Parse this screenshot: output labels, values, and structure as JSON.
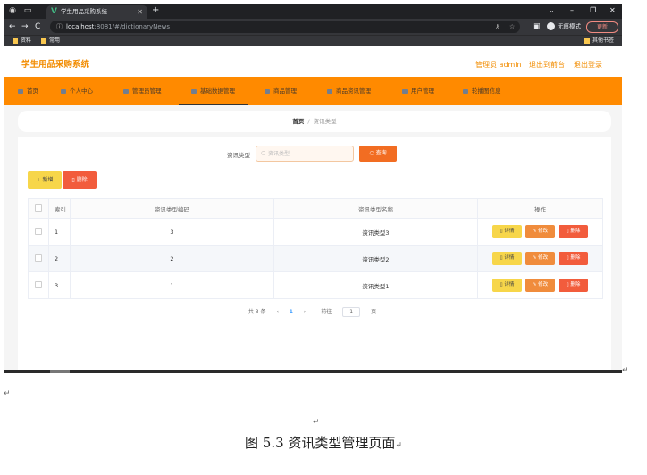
{
  "browser": {
    "tab_title": "学生用品采购系统",
    "url_host": "localhost",
    "url_rest": ":8081/#/dictionaryNews",
    "incognito_label": "无痕模式",
    "update_label": "更新",
    "bookmarks": [
      "资料",
      "常用"
    ],
    "other_bookmarks": "其他书签"
  },
  "header": {
    "brand": "学生用品采购系统",
    "admin_label": "管理员 admin",
    "back_label": "退出到前台",
    "logout_label": "退出登录"
  },
  "menu": {
    "items": [
      {
        "label": "首页",
        "icon": "home-icon"
      },
      {
        "label": "个人中心",
        "icon": "user-icon"
      },
      {
        "label": "管理员管理",
        "icon": "admin-icon"
      },
      {
        "label": "基础数据管理",
        "icon": "data-icon",
        "active": true
      },
      {
        "label": "商品管理",
        "icon": "goods-icon"
      },
      {
        "label": "商品资讯管理",
        "icon": "news-icon"
      },
      {
        "label": "用户管理",
        "icon": "users-icon"
      },
      {
        "label": "轮播图信息",
        "icon": "carousel-icon"
      }
    ]
  },
  "breadcrumb": {
    "home": "首页",
    "separator": "/",
    "current": "资讯类型"
  },
  "search": {
    "label": "资讯类型",
    "placeholder": "资讯类型",
    "button_label": "查询"
  },
  "toolbar": {
    "add_label": "+ 新增",
    "delete_label": "删除"
  },
  "table": {
    "headers": [
      "索引",
      "资讯类型编码",
      "资讯类型名称",
      "操作"
    ],
    "rows": [
      {
        "index": "1",
        "code": "3",
        "name": "资讯类型3"
      },
      {
        "index": "2",
        "code": "2",
        "name": "资讯类型2"
      },
      {
        "index": "3",
        "code": "1",
        "name": "资讯类型1"
      }
    ],
    "actions": {
      "view": "详情",
      "edit": "修改",
      "delete": "删除"
    }
  },
  "pagination": {
    "total_text": "共 3 条",
    "prev": "‹",
    "current_page": "1",
    "next": "›",
    "goto_label": "前往",
    "goto_value": "1",
    "page_suffix": "页"
  },
  "document": {
    "caption": "图 5.3 资讯类型管理页面",
    "paragraph_mark": "↵"
  },
  "colors": {
    "accent": "#ff8a00",
    "brand_text": "#f28c00",
    "query_button": "#f26d22",
    "add_button": "#f7d64a",
    "delete_button": "#f25c3c",
    "edit_button": "#f08c3c"
  }
}
